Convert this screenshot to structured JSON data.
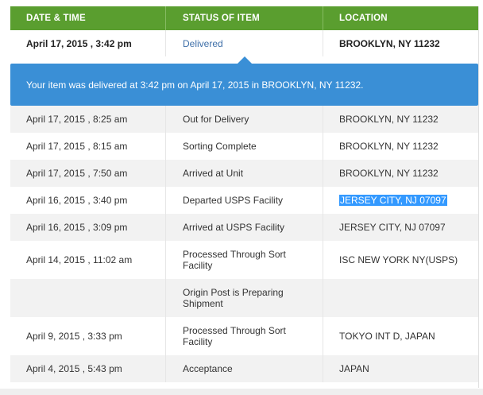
{
  "header": {
    "col1": "DATE & TIME",
    "col2": "STATUS OF ITEM",
    "col3": "LOCATION"
  },
  "delivered": {
    "date": "April 17, 2015 , 3:42 pm",
    "status": "Delivered",
    "location": "BROOKLYN, NY 11232"
  },
  "banner": {
    "message": "Your item was delivered at 3:42 pm on April 17, 2015 in BROOKLYN, NY 11232."
  },
  "rows": [
    {
      "date": "April 17, 2015 , 8:25 am",
      "status": "Out for Delivery",
      "location": "BROOKLYN, NY 11232"
    },
    {
      "date": "April 17, 2015 , 8:15 am",
      "status": "Sorting Complete",
      "location": "BROOKLYN, NY 11232"
    },
    {
      "date": "April 17, 2015 , 7:50 am",
      "status": "Arrived at Unit",
      "location": "BROOKLYN, NY 11232"
    },
    {
      "date": "April 16, 2015 , 3:40 pm",
      "status": "Departed USPS Facility",
      "location": "JERSEY CITY, NJ 07097"
    },
    {
      "date": "April 16, 2015 , 3:09 pm",
      "status": "Arrived at USPS Facility",
      "location": "JERSEY CITY, NJ 07097"
    },
    {
      "date": "April 14, 2015 , 11:02 am",
      "status_line1": "Processed Through Sort",
      "status_line2": "Facility",
      "location": "ISC NEW YORK NY(USPS)"
    },
    {
      "date": "",
      "status_line1": "Origin Post is Preparing",
      "status_line2": "Shipment",
      "location": ""
    },
    {
      "date": "April 9, 2015 , 3:33 pm",
      "status_line1": "Processed Through Sort",
      "status_line2": "Facility",
      "location": "TOKYO INT D, JAPAN"
    },
    {
      "date": "April 4, 2015 , 5:43 pm",
      "status": "Acceptance",
      "location": "JAPAN"
    }
  ],
  "colors": {
    "header_bg": "#5a9e2f",
    "banner_bg": "#3a8fd6",
    "status_link": "#3e6fa8",
    "selection": "#3399ff"
  }
}
